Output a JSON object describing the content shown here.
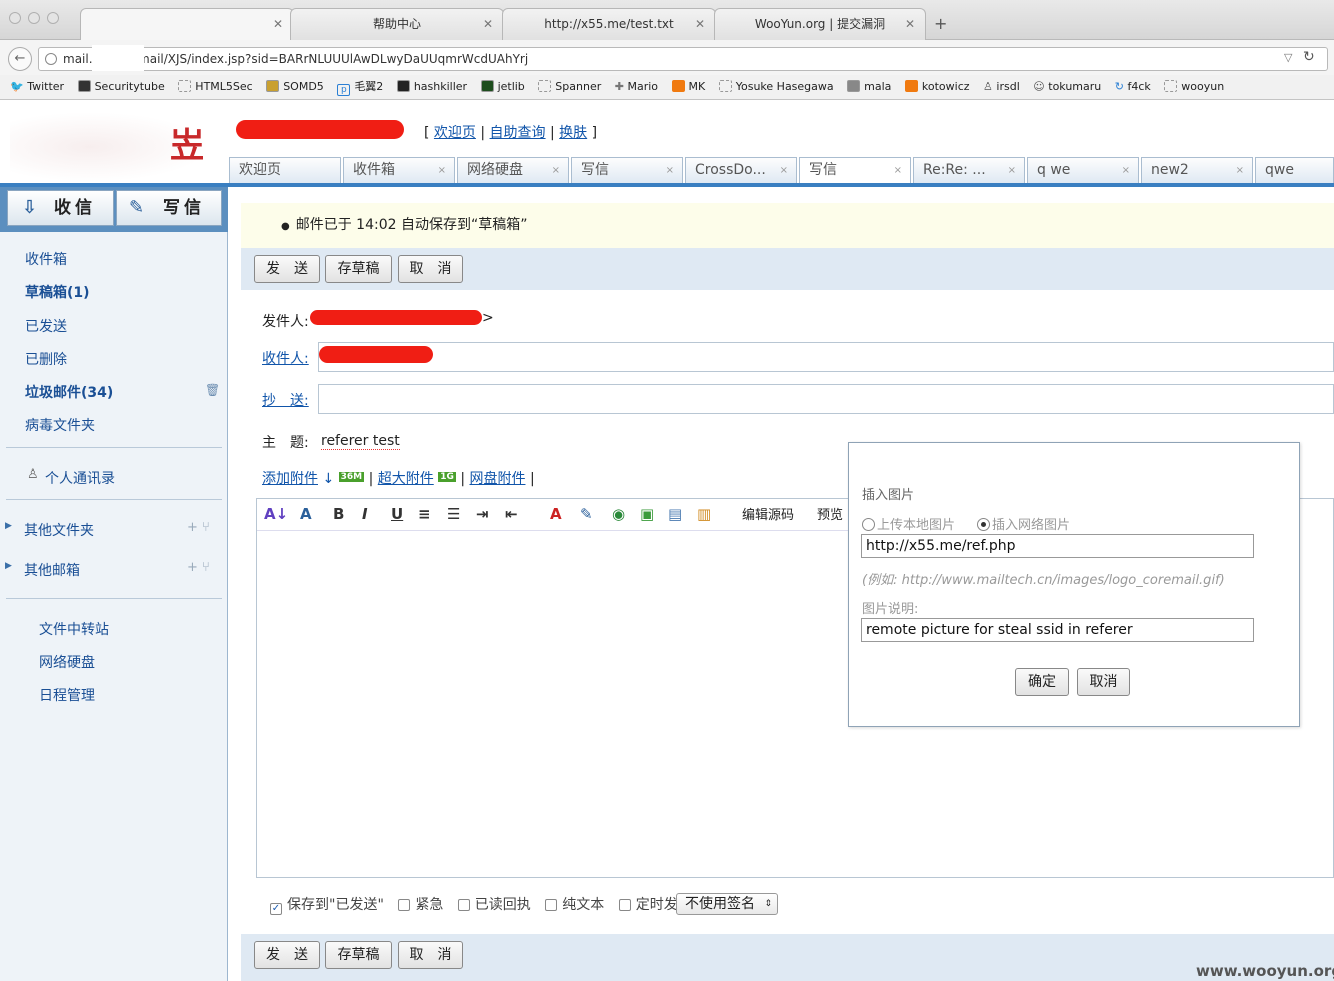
{
  "browser": {
    "tabs": [
      {
        "label": "",
        "active": true
      },
      {
        "label": "帮助中心"
      },
      {
        "label": "http://x55.me/test.txt"
      },
      {
        "label": "WooYun.org | 提交漏洞"
      }
    ],
    "new_tab": "+",
    "url": "mail.:          n/coremail/XJS/index.jsp?sid=BARrNLUUUlAwDLwyDaUUqmrWcdUAhYrj",
    "bookmarks": [
      "Twitter",
      "Securitytube",
      "HTML5Sec",
      "SOMD5",
      "毛翼2",
      "hashkiller",
      "jetlib",
      "Spanner",
      "Mario",
      "MK",
      "Yosuke Hasegawa",
      "mala",
      "kotowicz",
      "irsdl",
      "tokumaru",
      "f4ck",
      "wooyun"
    ]
  },
  "header": {
    "links": [
      "欢迎页",
      "自助查询",
      "换肤"
    ],
    "open_bracket": "[",
    "close_bracket": "]",
    "separator": "|"
  },
  "mail_tabs": [
    "欢迎页",
    "收件箱",
    "网络硬盘",
    "写信",
    "CrossDo...",
    "写信",
    "Re:Re: ...",
    "q we",
    "new2",
    "qwe"
  ],
  "tab_close": "×",
  "sidebar": {
    "receive": "收信",
    "compose": "写信",
    "folders": [
      {
        "label": "收件箱"
      },
      {
        "label": "草稿箱(1)",
        "bold": true
      },
      {
        "label": "已发送"
      },
      {
        "label": "已删除"
      },
      {
        "label": "垃圾邮件(34)",
        "bold": true
      },
      {
        "label": "病毒文件夹"
      }
    ],
    "contacts": "个人通讯录",
    "other_folders": "其他文件夹",
    "other_mailboxes": "其他邮箱",
    "tools": [
      "文件中转站",
      "网络硬盘",
      "日程管理"
    ]
  },
  "notice": "邮件已于 14:02 自动保存到“草稿箱”",
  "actions": {
    "send": "发　送",
    "save_draft": "存草稿",
    "cancel": "取　消"
  },
  "form": {
    "from_label": "发件人:",
    "from_suffix": ">",
    "to_label": "收件人:",
    "cc_label": "抄　送:",
    "subject_label": "主　题:",
    "subject_value": "referer test"
  },
  "attachments": {
    "add": "添加附件",
    "add_badge": "36M",
    "large": "超大附件",
    "large_badge": "1G",
    "disk": "网盘附件",
    "separator": "|"
  },
  "editor_toolbar": {
    "source": "编辑源码",
    "preview": "预览"
  },
  "dialog": {
    "title": "插入图片",
    "option_local": "上传本地图片",
    "option_web": "插入网络图片",
    "url_value": "http://x55.me/ref.php",
    "example": "(例如: http://www.mailtech.cn/images/logo_coremail.gif)",
    "desc_label": "图片说明:",
    "desc_value": "remote picture for steal ssid in referer",
    "ok": "确定",
    "cancel": "取消"
  },
  "options": {
    "save_sent": "保存到\"已发送\"",
    "urgent": "紧急",
    "read_receipt": "已读回执",
    "plain_text": "纯文本",
    "scheduled": "定时发送",
    "signature": "不使用签名"
  },
  "watermark": "www.wooyun.org"
}
